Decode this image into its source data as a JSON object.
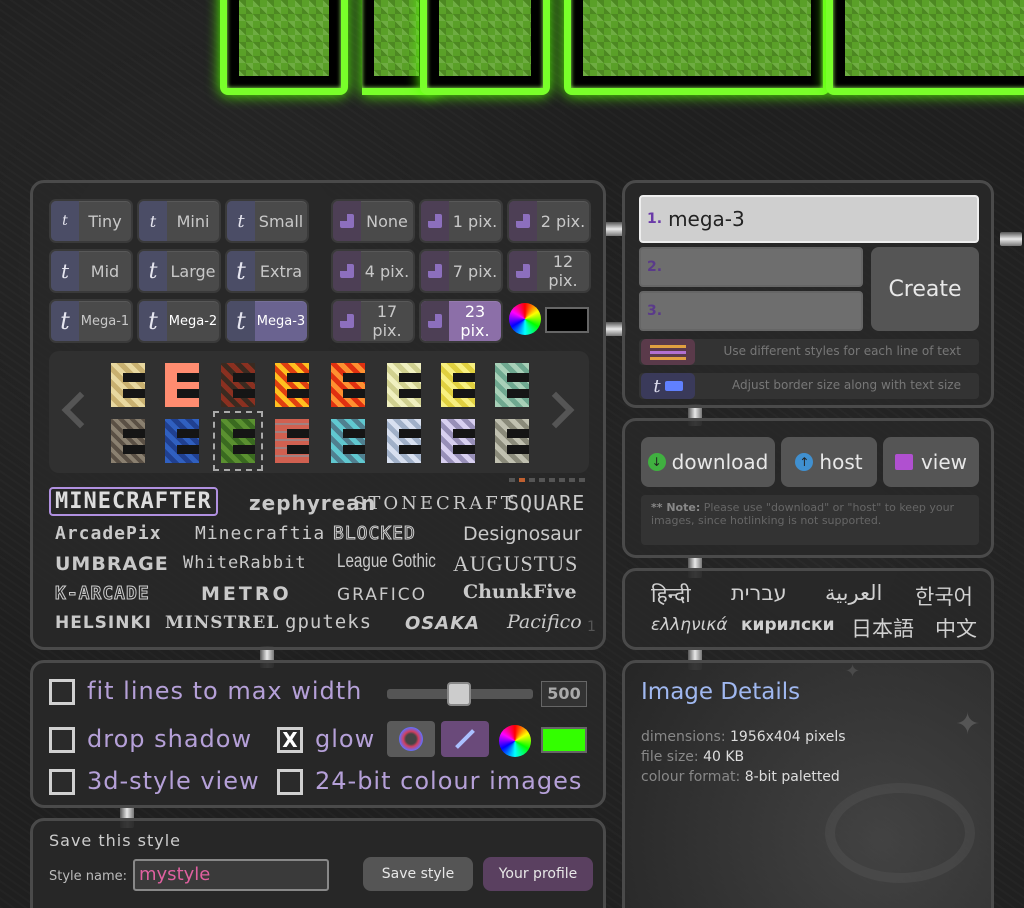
{
  "size_buttons": [
    {
      "label": "Tiny"
    },
    {
      "label": "Mini"
    },
    {
      "label": "Small"
    },
    {
      "label": "Mid"
    },
    {
      "label": "Large"
    },
    {
      "label": "Extra"
    },
    {
      "label": "Mega-1"
    },
    {
      "label": "Mega-2"
    },
    {
      "label": "Mega-3",
      "selected": true
    }
  ],
  "border_buttons": [
    {
      "label": "None"
    },
    {
      "label": "1 pix."
    },
    {
      "label": "2 pix."
    },
    {
      "label": "4 pix."
    },
    {
      "label": "7 pix."
    },
    {
      "label": "12 pix."
    },
    {
      "label": "17 pix."
    },
    {
      "label": "23 pix.",
      "selected": true
    }
  ],
  "border_color": "#000000",
  "fonts": [
    "MINECRAFTER",
    "zephyrean",
    "STONECRAFT",
    "SQUARE",
    "ArcadePix",
    "Minecraftia",
    "BLOCKED",
    "Designosaur",
    "UMBRAGE",
    "WhiteRabbit",
    "League Gothic",
    "AUGUSTUS",
    "K-ARCADE",
    "METRO",
    "GRAFICO",
    "ChunkFive",
    "HELSINKI",
    "MINSTREL",
    "gputeks",
    "OSAKA",
    "Pacifico"
  ],
  "fonts_page": "1",
  "options": {
    "fit_label": "fit lines to max width",
    "width_value": "500",
    "shadow_label": "drop shadow",
    "glow_label": "glow",
    "glow_checked": "X",
    "view3d_label": "3d-style view",
    "colour24_label": "24-bit colour images",
    "glow_color": "#33ff00"
  },
  "save_style": {
    "title": "Save this style",
    "name_label": "Style name:",
    "name_value": "mystyle",
    "save_button": "Save style",
    "profile_button": "Your profile"
  },
  "text_lines": {
    "line1_num": "1.",
    "line1_value": "mega-3",
    "line2_num": "2.",
    "line3_num": "3.",
    "create_button": "Create",
    "styles_hint": "Use different styles for each line of text",
    "border_hint": "Adjust border size along with text size"
  },
  "actions": {
    "download": "download",
    "host": "host",
    "view": "view",
    "note_bold": "** Note:",
    "note_text": "Please use \"download\" or \"host\" to keep your images, since hotlinking is not supported."
  },
  "languages": [
    "हिन्दी",
    "עברית",
    "العربية",
    "한국어",
    "ελληνικά",
    "кирилски",
    "日本語",
    "中文"
  ],
  "details": {
    "title": "Image Details",
    "dimensions_label": "dimensions:",
    "dimensions_value": "1956x404 pixels",
    "filesize_label": "file size:",
    "filesize_value": "40 KB",
    "colour_label": "colour format:",
    "colour_value": "8-bit paletted"
  }
}
